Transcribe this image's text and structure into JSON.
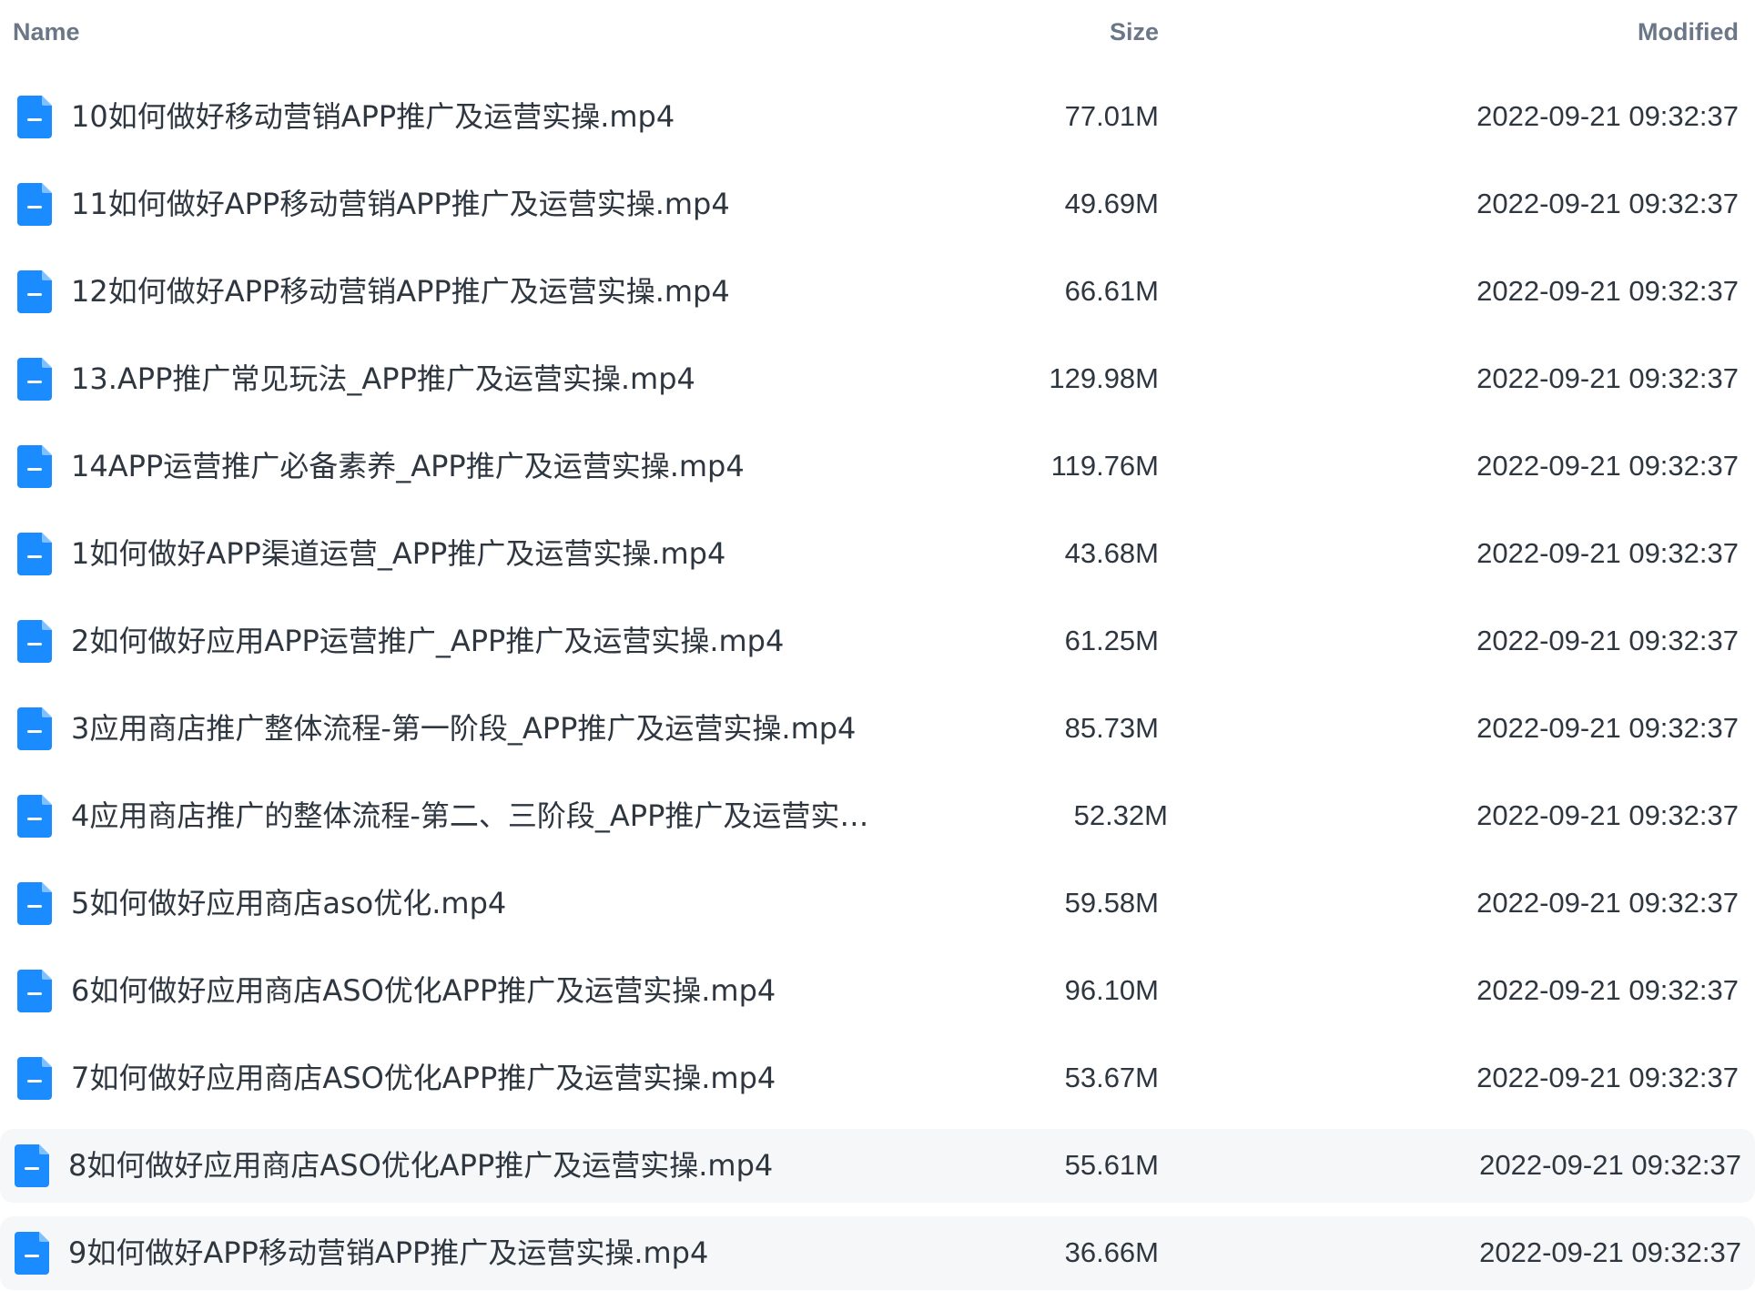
{
  "colors": {
    "icon": "#1a8cff",
    "header_text": "#6b7787",
    "row_text": "#2e3640",
    "hover_row_bg": "#f6f7f8"
  },
  "columns": {
    "name": "Name",
    "size": "Size",
    "modified": "Modified"
  },
  "files": [
    {
      "name": "10如何做好移动营销APP推广及运营实操.mp4",
      "size": "77.01M",
      "modified": "2022-09-21 09:32:37",
      "icon": "file-icon"
    },
    {
      "name": "11如何做好APP移动营销APP推广及运营实操.mp4",
      "size": "49.69M",
      "modified": "2022-09-21 09:32:37",
      "icon": "file-icon"
    },
    {
      "name": "12如何做好APP移动营销APP推广及运营实操.mp4",
      "size": "66.61M",
      "modified": "2022-09-21 09:32:37",
      "icon": "file-icon"
    },
    {
      "name": "13.APP推广常见玩法_APP推广及运营实操.mp4",
      "size": "129.98M",
      "modified": "2022-09-21 09:32:37",
      "icon": "file-icon"
    },
    {
      "name": "14APP运营推广必备素养_APP推广及运营实操.mp4",
      "size": "119.76M",
      "modified": "2022-09-21 09:32:37",
      "icon": "file-icon"
    },
    {
      "name": "1如何做好APP渠道运营_APP推广及运营实操.mp4",
      "size": "43.68M",
      "modified": "2022-09-21 09:32:37",
      "icon": "file-icon"
    },
    {
      "name": "2如何做好应用APP运营推广_APP推广及运营实操.mp4",
      "size": "61.25M",
      "modified": "2022-09-21 09:32:37",
      "icon": "file-icon"
    },
    {
      "name": "3应用商店推广整体流程-第一阶段_APP推广及运营实操.mp4",
      "size": "85.73M",
      "modified": "2022-09-21 09:32:37",
      "icon": "file-icon"
    },
    {
      "name": "4应用商店推广的整体流程-第二、三阶段_APP推广及运营实…",
      "size": "52.32M",
      "modified": "2022-09-21 09:32:37",
      "icon": "file-icon"
    },
    {
      "name": "5如何做好应用商店aso优化.mp4",
      "size": "59.58M",
      "modified": "2022-09-21 09:32:37",
      "icon": "file-icon"
    },
    {
      "name": "6如何做好应用商店ASO优化APP推广及运营实操.mp4",
      "size": "96.10M",
      "modified": "2022-09-21 09:32:37",
      "icon": "file-icon"
    },
    {
      "name": "7如何做好应用商店ASO优化APP推广及运营实操.mp4",
      "size": "53.67M",
      "modified": "2022-09-21 09:32:37",
      "icon": "file-icon"
    },
    {
      "name": "8如何做好应用商店ASO优化APP推广及运营实操.mp4",
      "size": "55.61M",
      "modified": "2022-09-21 09:32:37",
      "icon": "file-icon"
    },
    {
      "name": "9如何做好APP移动营销APP推广及运营实操.mp4",
      "size": "36.66M",
      "modified": "2022-09-21 09:32:37",
      "icon": "file-icon"
    }
  ]
}
